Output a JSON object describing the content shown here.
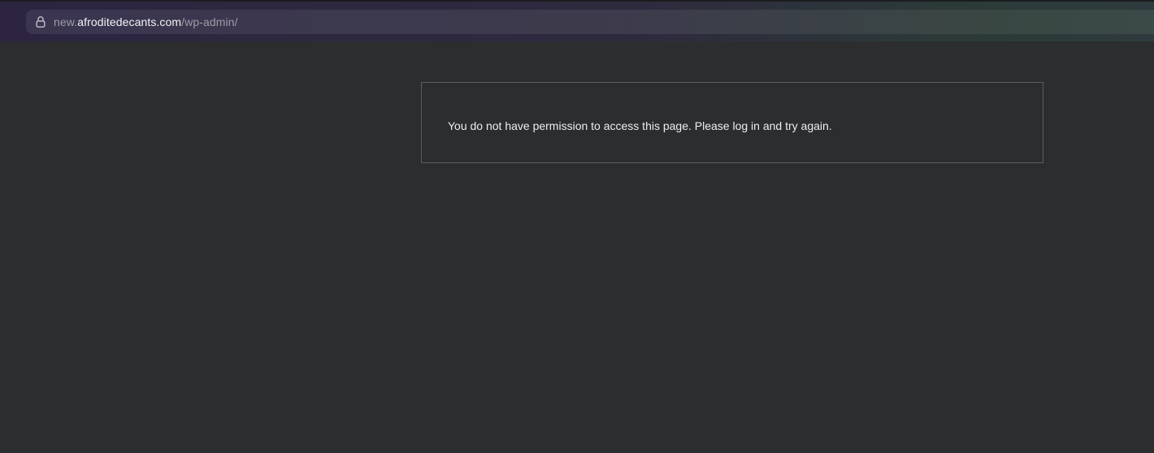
{
  "browser": {
    "url": {
      "prefix": "new.",
      "host": "afroditedecants.com",
      "path": "/wp-admin/"
    },
    "lock_icon": "lock-icon"
  },
  "page": {
    "message": "You do not have permission to access this page. Please log in and try again."
  },
  "colors": {
    "background": "#2c2d2f",
    "border": "#5b5c5f",
    "text": "#eeeeee"
  }
}
